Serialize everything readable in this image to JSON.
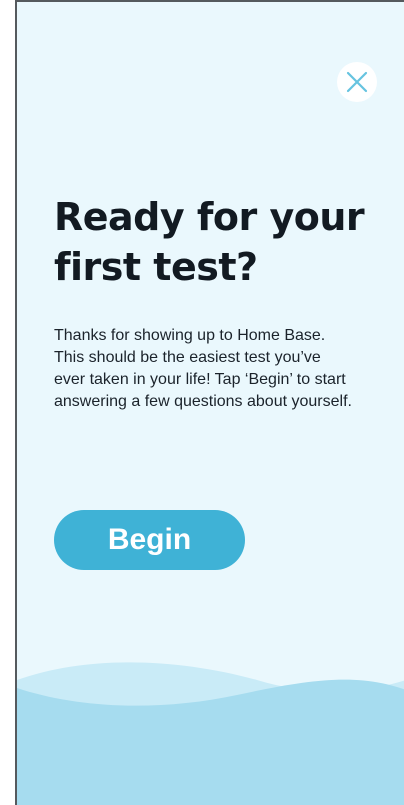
{
  "screen": {
    "title": "Ready for your first test?",
    "body": "Thanks for showing up to Home Base. This should be the easiest test you’ve ever taken in your life! Tap ‘Begin’ to start answering a few questions about yourself.",
    "begin_label": "Begin",
    "close_icon": "close-icon"
  },
  "colors": {
    "background": "#eaf8fd",
    "accent": "#3fb2d6",
    "close_icon": "#66c3e0",
    "wave_light": "#c9ebf7",
    "wave_dark": "#a6dcef",
    "text": "#121a22"
  }
}
